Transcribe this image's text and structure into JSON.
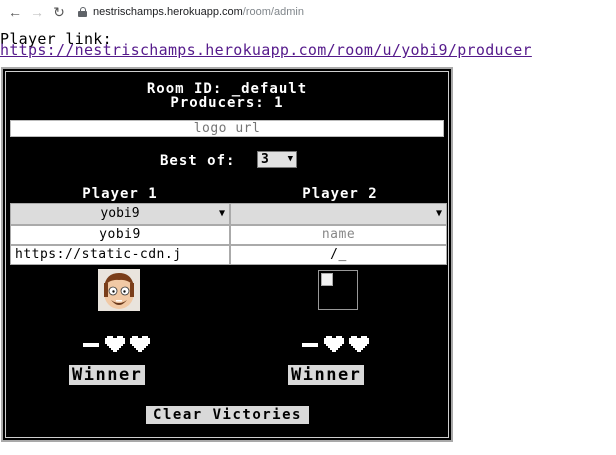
{
  "browser": {
    "host": "nestrischamps.herokuapp.com",
    "path": "/room/admin"
  },
  "player_link": {
    "label": "Player link:",
    "url": "https://nestrischamps.herokuapp.com/room/u/yobi9/producer"
  },
  "room": {
    "id_line": "Room ID: _default",
    "producers_line": "Producers: 1",
    "logo_placeholder": "logo url",
    "best_of_label": "Best of:",
    "best_of_value": "3"
  },
  "players": [
    {
      "heading": "Player 1",
      "selected": "yobi9",
      "name_value": "yobi9",
      "name_placeholder": "name",
      "avatar_url": "https://static-cdn.j",
      "victory_hearts": 2,
      "winner_label": "Winner"
    },
    {
      "heading": "Player 2",
      "selected": "",
      "name_value": "",
      "name_placeholder": "name",
      "avatar_url": "/_",
      "victory_hearts": 2,
      "winner_label": "Winner"
    }
  ],
  "clear_label": "Clear Victories"
}
